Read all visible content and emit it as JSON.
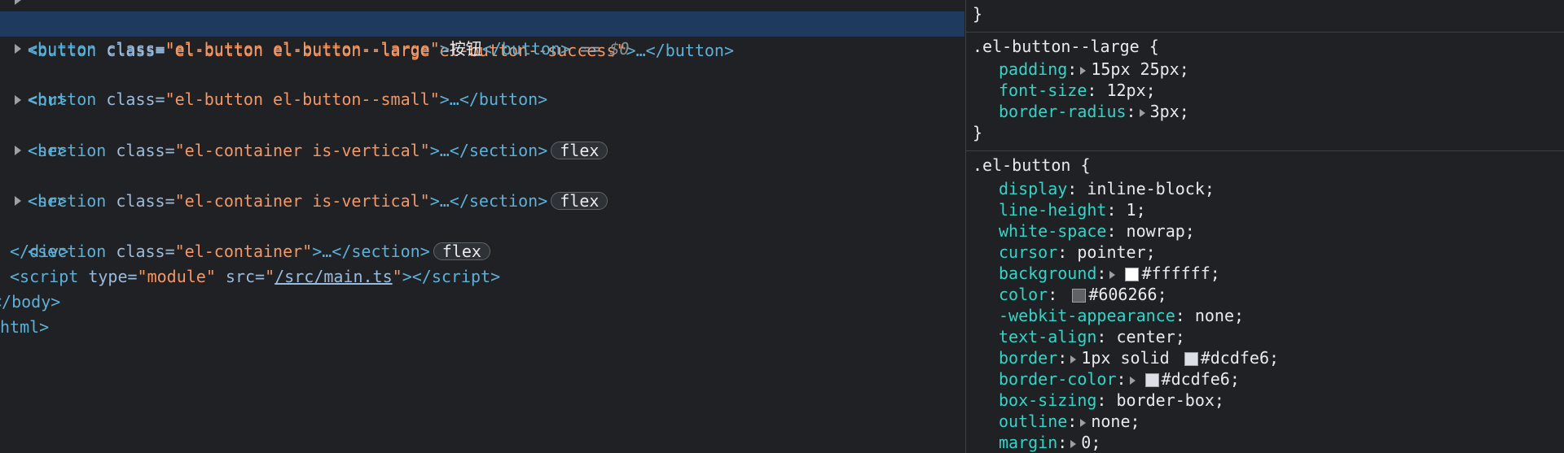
{
  "elements_panel": {
    "rows": [
      {
        "pre": "<",
        "tag": "button",
        "attr": " class=",
        "value": "\"el-button el-button--large el-button--success\"",
        "post": ">…</",
        "tag2": "button",
        "end": ">"
      },
      {
        "pre": "<",
        "tag": "button",
        "attr": " class=",
        "value": "\"el-button el-button--large\"",
        "gt": ">",
        "text": "按钮",
        "close": "</button>",
        "sel": " == ",
        "var": "$0"
      },
      {
        "pre": "<",
        "tag": "button",
        "attr": " class=",
        "value": "\"el-button el-button--small\"",
        "post": ">…</",
        "tag2": "button",
        "end": ">"
      },
      {
        "text": "<hr>"
      },
      {
        "pre": "<",
        "tag": "section",
        "attr": " class=",
        "value": "\"el-container is-vertical\"",
        "post": ">…</",
        "tag2": "section",
        "end": ">",
        "badge": "flex"
      },
      {
        "text": "<hr>"
      },
      {
        "pre": "<",
        "tag": "section",
        "attr": " class=",
        "value": "\"el-container is-vertical\"",
        "post": ">…</",
        "tag2": "section",
        "end": ">",
        "badge": "flex"
      },
      {
        "text": "<hr>"
      },
      {
        "pre": "<",
        "tag": "section",
        "attr": " class=",
        "value": "\"el-container\"",
        "post": ">…</",
        "tag2": "section",
        "end": ">",
        "badge": "flex"
      },
      {
        "text": "</div>"
      },
      {
        "pre": "<",
        "tag": "script",
        "attr1": " type=",
        "val1": "\"module\"",
        "attr2": " src=",
        "q1": "\"",
        "link": "/src/main.ts",
        "q2": "\"",
        "post": "></",
        "tag2": "script",
        "end": ">"
      },
      {
        "text": "</body>"
      },
      {
        "text": "html>"
      }
    ]
  },
  "styles_panel": {
    "top_brace": "}",
    "rule_large": {
      "selector": ".el-button--large {",
      "props": [
        {
          "name": "padding",
          "value": "15px 25px;",
          "expandable": true
        },
        {
          "name": "font-size",
          "value": "12px;"
        },
        {
          "name": "border-radius",
          "value": "3px;",
          "expandable": true
        }
      ],
      "close": "}"
    },
    "rule_button": {
      "selector": ".el-button {",
      "props": [
        {
          "name": "display",
          "value": "inline-block;"
        },
        {
          "name": "line-height",
          "value": "1;"
        },
        {
          "name": "white-space",
          "value": "nowrap;"
        },
        {
          "name": "cursor",
          "value": "pointer;"
        },
        {
          "name": "background",
          "value": "#ffffff;",
          "expandable": true,
          "swatch": "#ffffff"
        },
        {
          "name": "color",
          "value": "#606266;",
          "swatch": "#606266"
        },
        {
          "name": "-webkit-appearance",
          "value": "none;"
        },
        {
          "name": "text-align",
          "value": "center;"
        },
        {
          "name": "border",
          "value": "1px solid ",
          "value2": "#dcdfe6;",
          "expandable": true,
          "swatch": "#dcdfe6"
        },
        {
          "name": "border-color",
          "value": "#dcdfe6;",
          "expandable": true,
          "swatch": "#dcdfe6"
        },
        {
          "name": "box-sizing",
          "value": "border-box;"
        },
        {
          "name": "outline",
          "value": "none;",
          "expandable": true
        },
        {
          "name": "margin",
          "value": "0;",
          "expandable": true
        }
      ]
    }
  }
}
